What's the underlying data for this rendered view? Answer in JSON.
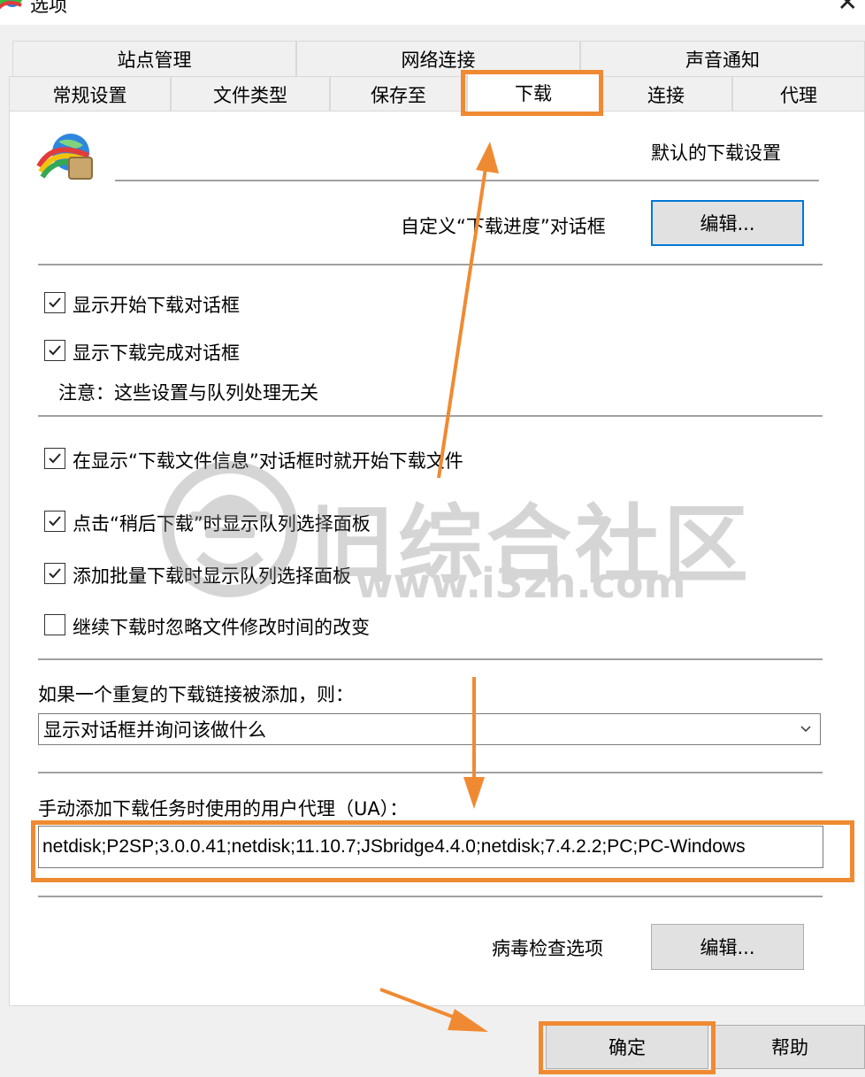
{
  "window": {
    "title": "选项",
    "close_glyph": "✕"
  },
  "tabs_row1": [
    {
      "label": "站点管理"
    },
    {
      "label": "网络连接"
    },
    {
      "label": "声音通知"
    }
  ],
  "tabs_row2": [
    {
      "label": "常规设置"
    },
    {
      "label": "文件类型"
    },
    {
      "label": "保存至"
    },
    {
      "label": "下载",
      "active": true
    },
    {
      "label": "连接"
    },
    {
      "label": "代理"
    }
  ],
  "header": {
    "icon": "idm-globe-icon",
    "title": "默认的下载设置"
  },
  "progress_dialog": {
    "label": "自定义“下载进度”对话框",
    "button": "编辑..."
  },
  "checkboxes_group1": [
    {
      "label": "显示开始下载对话框",
      "checked": true
    },
    {
      "label": "显示下载完成对话框",
      "checked": true
    }
  ],
  "note": "注意：这些设置与队列处理无关",
  "checkboxes_group2": [
    {
      "label": "在显示“下载文件信息”对话框时就开始下载文件",
      "checked": true
    },
    {
      "label": "点击“稍后下载”时显示队列选择面板",
      "checked": true
    },
    {
      "label": "添加批量下载时显示队列选择面板",
      "checked": true
    },
    {
      "label": "继续下载时忽略文件修改时间的改变",
      "checked": false
    }
  ],
  "duplicate": {
    "label": "如果一个重复的下载链接被添加，则：",
    "selected": "显示对话框并询问该做什么"
  },
  "user_agent": {
    "label": "手动添加下载任务时使用的用户代理（UA）：",
    "value": "netdisk;P2SP;3.0.0.41;netdisk;11.10.7;JSbridge4.4.0;netdisk;7.4.2.2;PC;PC-Windows"
  },
  "virus": {
    "label": "病毒检查选项",
    "button": "编辑..."
  },
  "footer": {
    "ok": "确定",
    "help": "帮助"
  },
  "watermark": {
    "text": "旧综合社区",
    "url": "www.i3zh.com"
  },
  "colors": {
    "highlight": "#f08a32",
    "focus_border": "#0078d7",
    "panel_bg": "#ffffff",
    "window_bg": "#f0f0f0"
  }
}
